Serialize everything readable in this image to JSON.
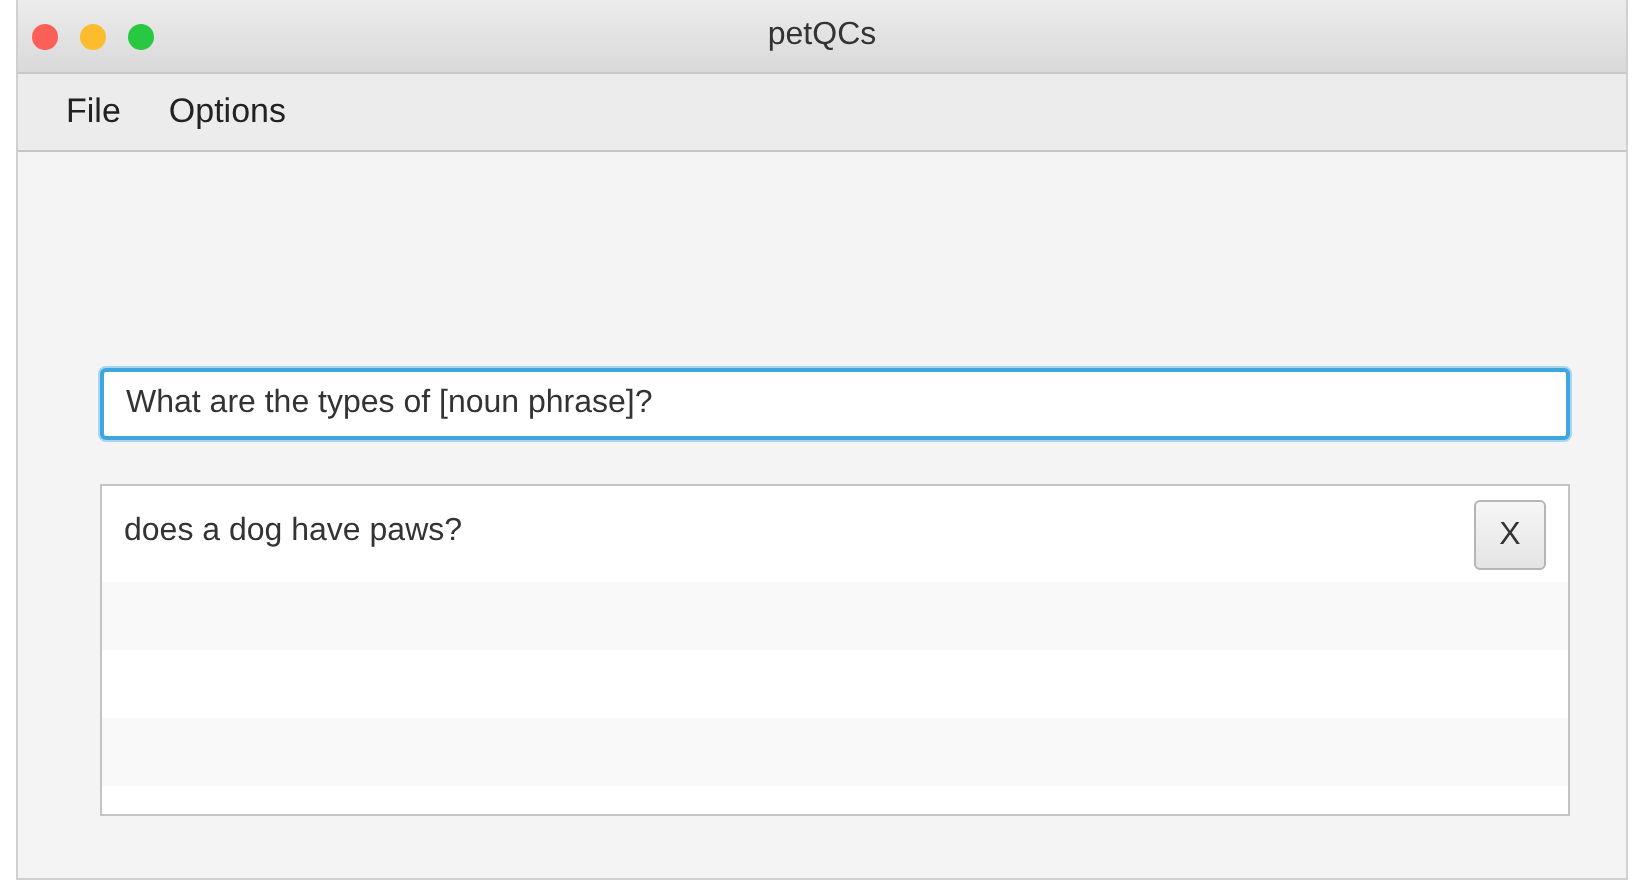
{
  "window": {
    "title": "petQCs"
  },
  "menu": [
    {
      "label": "File"
    },
    {
      "label": "Options"
    }
  ],
  "query_field": {
    "value": "What are the types of [noun phrase]?"
  },
  "results": [
    {
      "text": "does a dog have paws?",
      "remove_button": "X"
    }
  ]
}
